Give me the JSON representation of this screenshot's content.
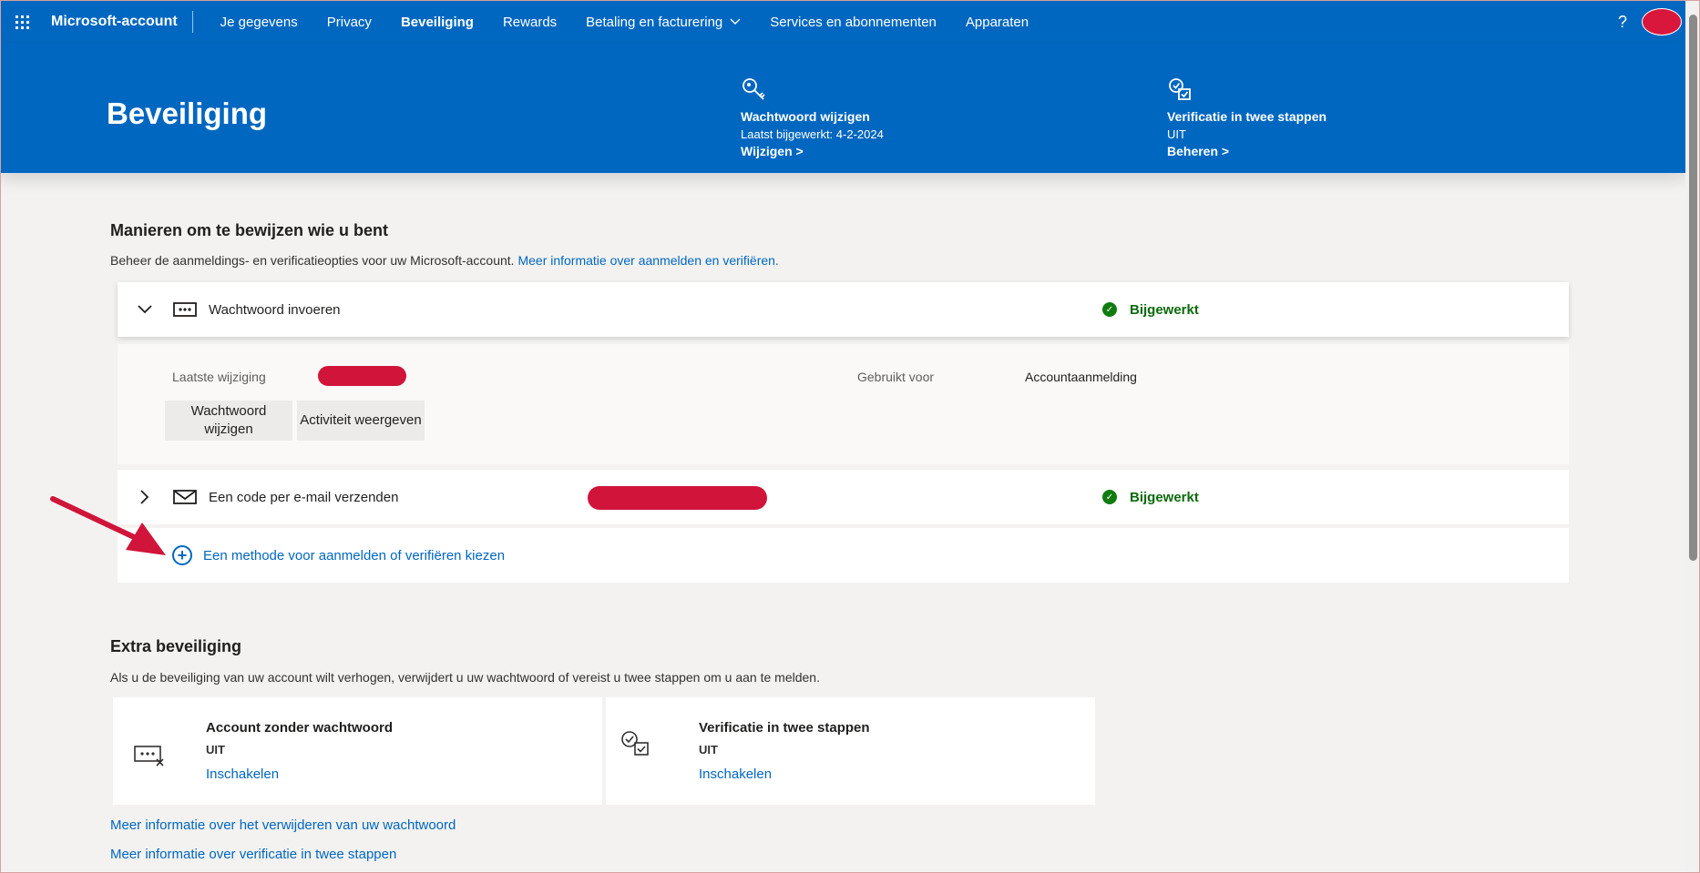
{
  "nav": {
    "brand": "Microsoft-account",
    "links": [
      "Je gegevens",
      "Privacy",
      "Beveiliging",
      "Rewards",
      "Betaling en facturering",
      "Services en abonnementen",
      "Apparaten"
    ],
    "help": "?"
  },
  "hero": {
    "title": "Beveiliging",
    "password": {
      "title": "Wachtwoord wijzigen",
      "sub": "Laatst bijgewerkt: 4-2-2024",
      "link": "Wijzigen >"
    },
    "twostep": {
      "title": "Verificatie in twee stappen",
      "sub": "UIT",
      "link": "Beheren >"
    }
  },
  "ways": {
    "title": "Manieren om te bewijzen wie u bent",
    "desc": "Beheer de aanmeldings- en verificatieopties voor uw Microsoft-account.",
    "desc_link": "Meer informatie over aanmelden en verifiëren.",
    "password_row": {
      "label": "Wachtwoord invoeren",
      "status": "Bijgewerkt"
    },
    "detail": {
      "last_change": "Laatste wijziging",
      "used_for": "Gebruikt voor",
      "used_for_value": "Accountaanmelding",
      "btn_change": "Wachtwoord wijzigen",
      "btn_activity": "Activiteit weergeven"
    },
    "email_row": {
      "label": "Een code per e-mail verzenden",
      "status": "Bijgewerkt"
    },
    "add_method": "Een methode voor aanmelden of verifiëren kiezen"
  },
  "extra": {
    "title": "Extra beveiliging",
    "desc": "Als u de beveiliging van uw account wilt verhogen, verwijdert u uw wachtwoord of vereist u twee stappen om u aan te melden.",
    "passwordless": {
      "title": "Account zonder wachtwoord",
      "status": "UIT",
      "link": "Inschakelen"
    },
    "twostep": {
      "title": "Verificatie in twee stappen",
      "status": "UIT",
      "link": "Inschakelen"
    },
    "link1": "Meer informatie over het verwijderen van uw wachtwoord",
    "link2": "Meer informatie over verificatie in twee stappen"
  },
  "colors": {
    "brand": "#0067c0",
    "success": "#107c10",
    "redaction": "#d0143a"
  }
}
